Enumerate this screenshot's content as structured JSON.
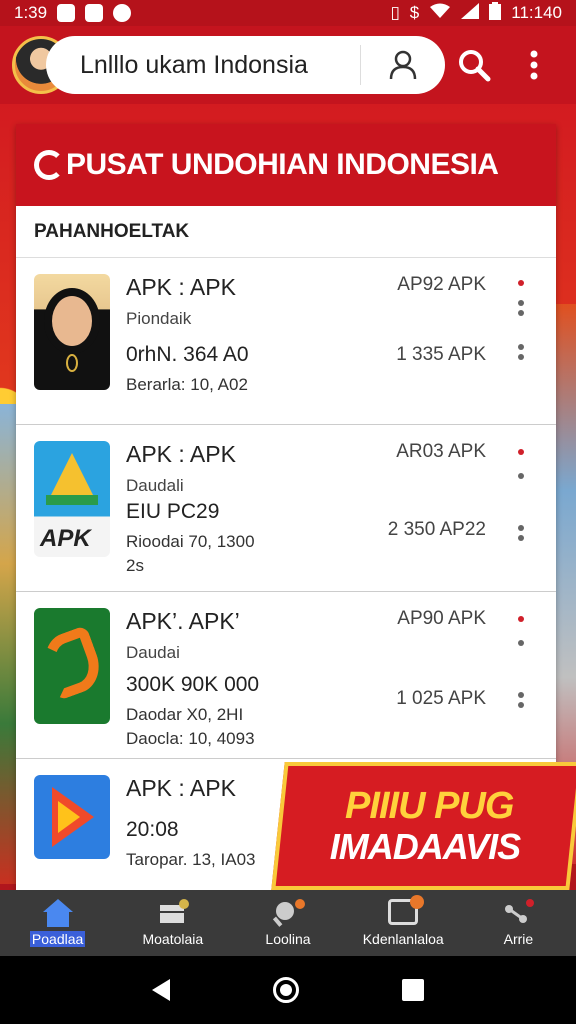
{
  "status_bar": {
    "time": "1:39",
    "clock_right": "11:140"
  },
  "app_bar": {
    "search_text": "Lnlllo ukam Indonsia"
  },
  "card": {
    "header_title": "PUSAT UNDOHIAN INDONESIA",
    "section_title": "PAHANHOELTAK"
  },
  "items": [
    {
      "title": "APK : APK",
      "subtitle": "Piondaik",
      "line3": "0rhN. 364  A0",
      "line4": "Berarla: 10, A02",
      "line5": "",
      "right_top": "AP92  APK",
      "right_mid": "1 335  APK"
    },
    {
      "title": "APK : APK",
      "subtitle": "Daudali",
      "line3": "EIU PC29",
      "line4": "Rioodai 70, 1300",
      "line5": "2s",
      "right_top": "AR03  APK",
      "right_mid": "2 350  AP22"
    },
    {
      "title": "APK’. APK’",
      "subtitle": "Daudai",
      "line3": "300K  90K 000",
      "line4": "Daodar X0, 2HI",
      "line5": "Daocla: 10, 4093",
      "right_top": "AP90  APK",
      "right_mid": "1 025  APK"
    },
    {
      "title": "APK : APK",
      "subtitle": "",
      "line3": "20:08",
      "line4": "Taropar. 13, IA03",
      "line5": "",
      "right_top": "",
      "right_mid": ""
    }
  ],
  "promo": {
    "line1": "PIIIU PUG",
    "line2": "IMADAAVIS"
  },
  "bottom_nav": [
    {
      "label": "Poadlaa",
      "icon": "home-icon",
      "active": true
    },
    {
      "label": "Moatolaia",
      "icon": "store-icon",
      "active": false
    },
    {
      "label": "Loolina",
      "icon": "ping-pong-icon",
      "active": false
    },
    {
      "label": "Kdenlanlaloa",
      "icon": "notes-icon",
      "active": false
    },
    {
      "label": "Arrie",
      "icon": "share-icon",
      "active": false
    }
  ],
  "colors": {
    "brand_red": "#c8141e",
    "gold": "#f9c93a",
    "nav_bg": "#3a3a3a",
    "active_blue": "#3a5fd9"
  }
}
